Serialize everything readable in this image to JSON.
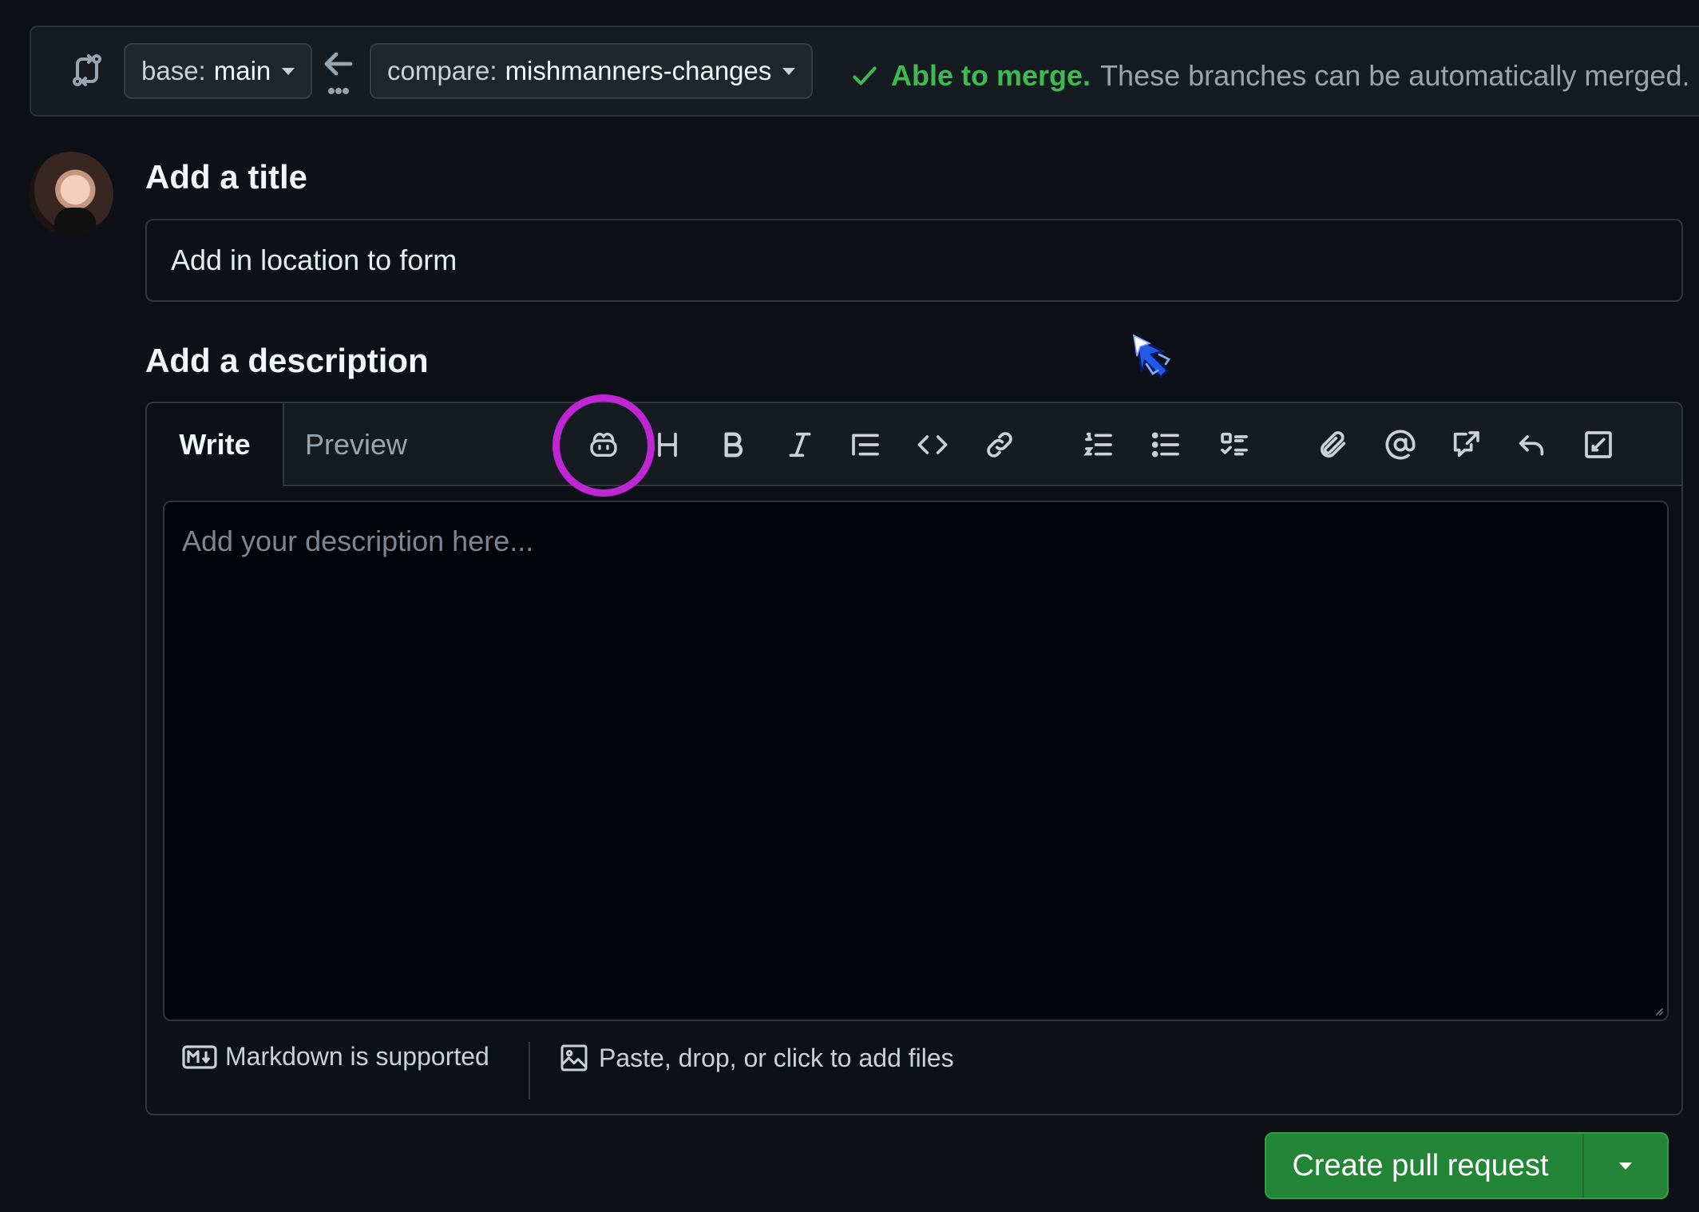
{
  "compare_bar": {
    "compare_icon": "git-compare-icon",
    "base_prefix": "base:",
    "base_branch": "main",
    "direction_icon": "arrow-left-icon",
    "compare_prefix": "compare:",
    "compare_branch": "mishmanners-changes",
    "merge_ok": "Able to merge.",
    "merge_message": "These branches can be automatically merged.",
    "status_color": "#3fb950"
  },
  "form": {
    "title_label": "Add a title",
    "title_value": "Add in location to form",
    "description_label": "Add a description"
  },
  "editor": {
    "tabs": [
      "Write",
      "Preview"
    ],
    "active_tab": "Write",
    "toolbar": [
      "copilot-icon",
      "heading-icon",
      "bold-icon",
      "italic-icon",
      "quote-icon",
      "code-icon",
      "link-icon",
      "ordered-list-icon",
      "unordered-list-icon",
      "task-list-icon",
      "attach-icon",
      "mention-icon",
      "reference-icon",
      "undo-icon",
      "fullscreen-icon"
    ],
    "highlight_color": "#c026d3",
    "placeholder": "Add your description here...",
    "markdown_note": "Markdown is supported",
    "files_note": "Paste, drop, or click to add files"
  },
  "actions": {
    "create_label": "Create pull request",
    "button_color": "#238636"
  }
}
